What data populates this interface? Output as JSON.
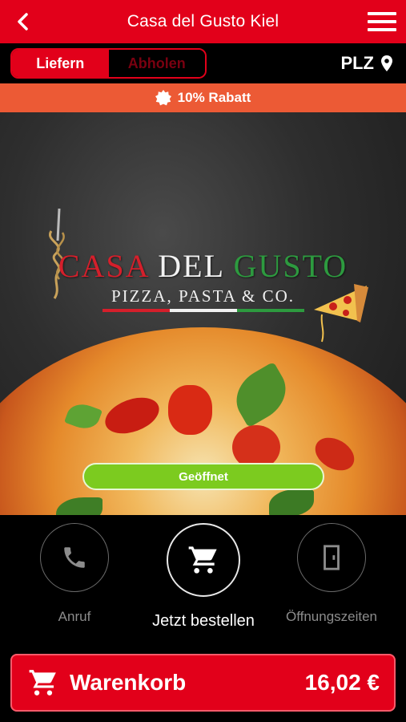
{
  "header": {
    "title": "Casa del Gusto Kiel",
    "back_icon": "chevron-left-icon",
    "menu_icon": "hamburger-menu-icon"
  },
  "order_mode": {
    "options": [
      "Liefern",
      "Abholen"
    ],
    "selected": "Liefern"
  },
  "plz": {
    "label": "PLZ",
    "icon": "map-pin-icon"
  },
  "promo": {
    "label": "10% Rabatt",
    "icon": "badge-icon"
  },
  "hero": {
    "logo_word1": "CASA",
    "logo_word2": "DEL",
    "logo_word3": "GUSTO",
    "logo_subtitle": "PIZZA, PASTA & CO.",
    "status": "Geöffnet"
  },
  "actions": [
    {
      "label": "Anruf",
      "icon": "phone-icon"
    },
    {
      "label": "Jetzt bestellen",
      "icon": "cart-icon"
    },
    {
      "label": "Öffnungszeiten",
      "icon": "door-icon"
    }
  ],
  "cart": {
    "label": "Warenkorb",
    "total": "16,02 €",
    "icon": "cart-icon"
  },
  "colors": {
    "primary": "#e2001a",
    "promo": "#ec5a35",
    "open": "#7ccb1f",
    "background": "#000000"
  }
}
